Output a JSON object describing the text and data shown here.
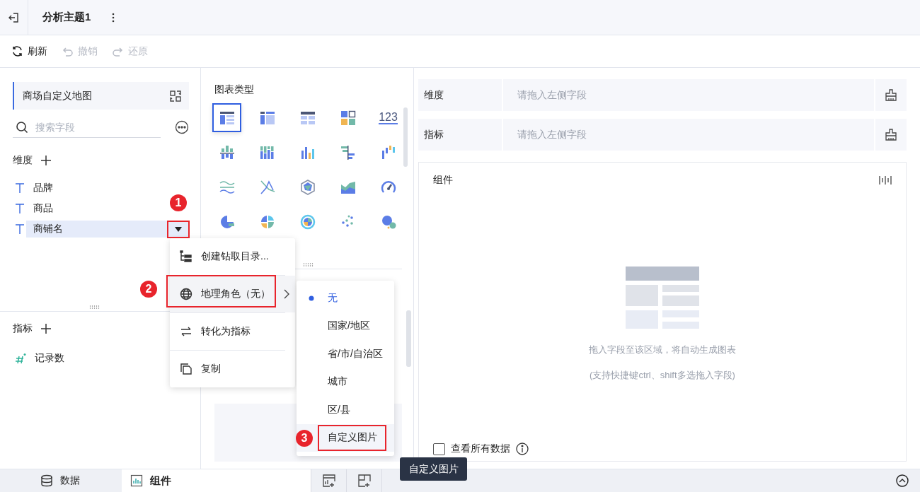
{
  "header": {
    "title": "分析主题1"
  },
  "toolbar": [
    {
      "kind": "refresh",
      "label": "刷新",
      "disabled": false
    },
    {
      "kind": "undo",
      "label": "撤销",
      "disabled": true
    },
    {
      "kind": "redo",
      "label": "还原",
      "disabled": true
    }
  ],
  "dataset": {
    "name": "商场自定义地图"
  },
  "search": {
    "placeholder": "搜索字段"
  },
  "dimensions": {
    "title": "维度",
    "fields": [
      {
        "name": "品牌",
        "selected": false
      },
      {
        "name": "商品",
        "selected": false
      },
      {
        "name": "商铺名",
        "selected": true
      }
    ]
  },
  "measures": {
    "title": "指标",
    "fields": [
      {
        "name": "记录数",
        "selected": false
      }
    ]
  },
  "chart_types": {
    "title": "图表类型",
    "items": [
      {
        "kind": "group-table",
        "selected": true
      },
      {
        "kind": "cross-table",
        "selected": false
      },
      {
        "kind": "detail-table",
        "selected": false
      },
      {
        "kind": "card",
        "selected": false
      },
      {
        "kind": "number",
        "label": "123",
        "selected": false
      },
      {
        "kind": "bar-grouped",
        "selected": false
      },
      {
        "kind": "bar-stacked",
        "selected": false
      },
      {
        "kind": "column",
        "selected": false
      },
      {
        "kind": "bar-horizontal",
        "selected": false
      },
      {
        "kind": "waterfall",
        "selected": false
      },
      {
        "kind": "line",
        "selected": false
      },
      {
        "kind": "line-cross",
        "selected": false
      },
      {
        "kind": "radar",
        "selected": false
      },
      {
        "kind": "area",
        "selected": false
      },
      {
        "kind": "gauge",
        "selected": false
      },
      {
        "kind": "pie",
        "selected": false
      },
      {
        "kind": "pie-split",
        "selected": false
      },
      {
        "kind": "sunburst",
        "selected": false
      },
      {
        "kind": "scatter",
        "selected": false
      },
      {
        "kind": "bubble",
        "selected": false
      }
    ]
  },
  "shelves": [
    {
      "label": "维度",
      "hint": "请拖入左侧字段"
    },
    {
      "label": "指标",
      "hint": "请拖入左侧字段"
    }
  ],
  "canvas": {
    "title": "组件",
    "messages": [
      "拖入字段至该区域，将自动生成图表",
      "(支持快捷键ctrl、shift多选拖入字段)"
    ],
    "checkbox": {
      "label": "查看所有数据",
      "checked": false
    }
  },
  "context_menu": {
    "items": [
      {
        "kind": "drill",
        "label": "创建钻取目录...",
        "expanded": false,
        "submenu": false
      },
      {
        "kind": "geo",
        "label": "地理角色（无）",
        "expanded": true,
        "submenu": true
      },
      {
        "kind": "convert",
        "label": "转化为指标",
        "expanded": false,
        "submenu": false
      },
      {
        "kind": "copy",
        "label": "复制",
        "expanded": false,
        "submenu": false
      }
    ]
  },
  "submenu": {
    "items": [
      {
        "label": "无",
        "selected": true,
        "highlighted": false
      },
      {
        "label": "国家/地区",
        "selected": false,
        "highlighted": false
      },
      {
        "label": "省/市/自治区",
        "selected": false,
        "highlighted": false
      },
      {
        "label": "城市",
        "selected": false,
        "highlighted": false
      },
      {
        "label": "区/县",
        "selected": false,
        "highlighted": false
      },
      {
        "label": "自定义图片",
        "selected": false,
        "highlighted": true
      }
    ]
  },
  "tooltip": {
    "text": "自定义图片"
  },
  "bottom_tabs": [
    {
      "kind": "data",
      "label": "数据",
      "selected": false
    },
    {
      "kind": "component",
      "label": "组件",
      "selected": true
    }
  ],
  "annotations": [
    {
      "label": "1"
    },
    {
      "label": "2"
    },
    {
      "label": "3"
    }
  ]
}
